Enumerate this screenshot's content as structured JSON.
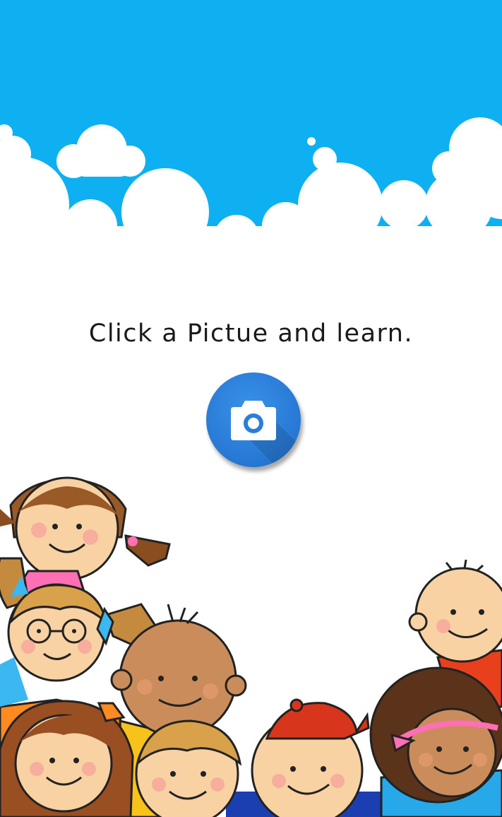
{
  "screen": {
    "headline": "Click a Pictue and learn."
  },
  "camera_button": {
    "icon": "camera-icon",
    "accent_color": "#2a7dd8"
  },
  "theme": {
    "sky_color": "#0fb0f2",
    "cloud_color": "#ffffff",
    "background": "#ffffff"
  },
  "illustration": {
    "subject": "cartoon-children"
  }
}
